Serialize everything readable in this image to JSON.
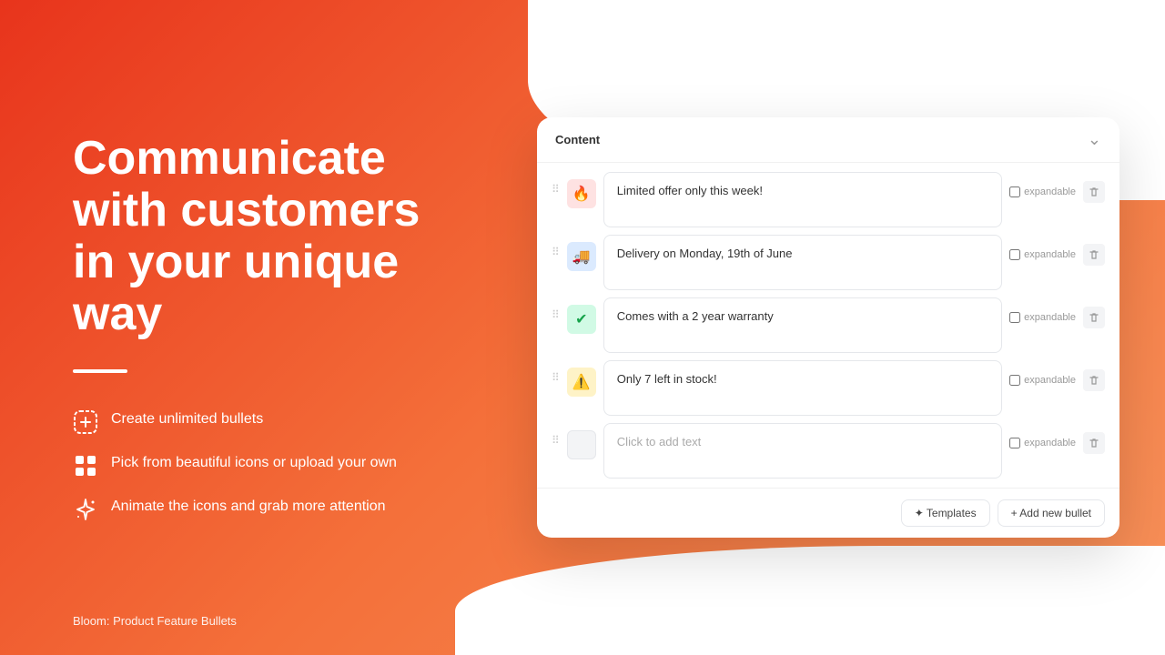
{
  "background": {
    "gradient_start": "#e8341c",
    "gradient_end": "#f7925a"
  },
  "left": {
    "headline": "Communicate with customers in your unique way",
    "divider": true,
    "features": [
      {
        "id": "feature-unlimited",
        "icon": "add-circle-dashed-icon",
        "text": "Create unlimited bullets"
      },
      {
        "id": "feature-icons",
        "icon": "grid-icon",
        "text": "Pick from beautiful icons or upload your own"
      },
      {
        "id": "feature-animate",
        "icon": "sparkle-icon",
        "text": "Animate the icons and grab more attention"
      }
    ],
    "bottom_label": "Bloom: Product Feature Bullets"
  },
  "widget": {
    "title": "Content",
    "collapse_icon": "chevron-up-icon",
    "bullets": [
      {
        "id": "bullet-1",
        "icon_type": "red",
        "icon": "fire-icon",
        "icon_char": "🔥",
        "text": "Limited offer only this week!",
        "placeholder": "",
        "expandable": false
      },
      {
        "id": "bullet-2",
        "icon_type": "blue",
        "icon": "truck-icon",
        "icon_char": "🚚",
        "text": "Delivery on Monday, 19th of June",
        "placeholder": "",
        "expandable": false
      },
      {
        "id": "bullet-3",
        "icon_type": "green",
        "icon": "check-circle-icon",
        "icon_char": "✅",
        "text": "Comes with a 2 year warranty",
        "placeholder": "",
        "expandable": false
      },
      {
        "id": "bullet-4",
        "icon_type": "orange",
        "icon": "warning-icon",
        "icon_char": "⚠️",
        "text": "Only 7 left in stock!",
        "placeholder": "",
        "expandable": false
      },
      {
        "id": "bullet-5",
        "icon_type": "empty",
        "icon": "empty-icon",
        "icon_char": "",
        "text": "",
        "placeholder": "Click to add text",
        "expandable": false
      }
    ],
    "footer": {
      "templates_label": "✦ Templates",
      "add_label": "+ Add new bullet"
    }
  }
}
